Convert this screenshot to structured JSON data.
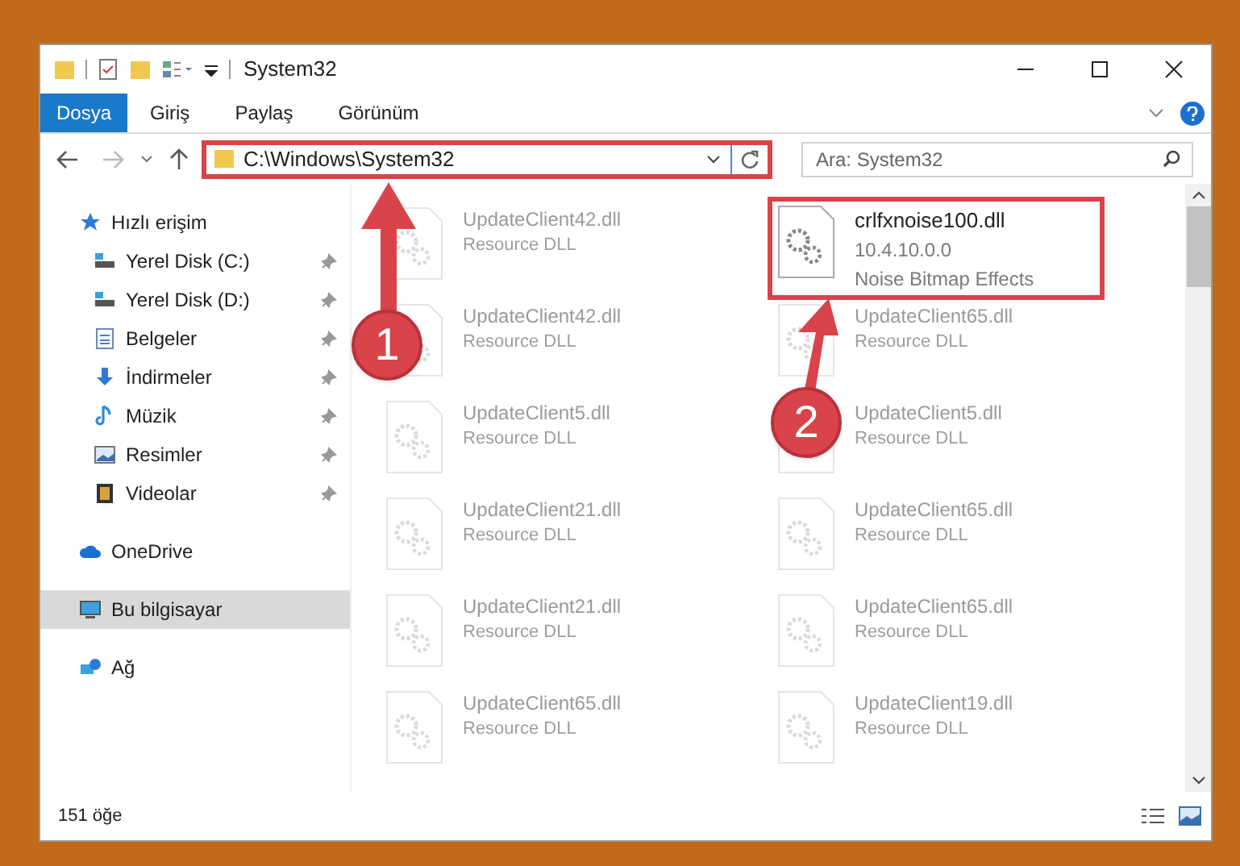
{
  "window": {
    "title": "System32"
  },
  "ribbon_tabs": [
    {
      "label": "Dosya",
      "selected": true
    },
    {
      "label": "Giriş",
      "selected": false
    },
    {
      "label": "Paylaş",
      "selected": false
    },
    {
      "label": "Görünüm",
      "selected": false
    }
  ],
  "address": {
    "path": "C:\\Windows\\System32"
  },
  "search": {
    "placeholder": "Ara: System32"
  },
  "sidebar": [
    {
      "label": "Hızlı erişim",
      "kind": "star",
      "pinned": false,
      "selected": false,
      "children": [
        {
          "label": "Yerel Disk (C:)",
          "kind": "drive",
          "pinned": true,
          "selected": false
        },
        {
          "label": "Yerel Disk (D:)",
          "kind": "drive",
          "pinned": true,
          "selected": false
        },
        {
          "label": "Belgeler",
          "kind": "document",
          "pinned": true,
          "selected": false
        },
        {
          "label": "İndirmeler",
          "kind": "download",
          "pinned": true,
          "selected": false
        },
        {
          "label": "Müzik",
          "kind": "music",
          "pinned": true,
          "selected": false
        },
        {
          "label": "Resimler",
          "kind": "pictures",
          "pinned": true,
          "selected": false
        },
        {
          "label": "Videolar",
          "kind": "video",
          "pinned": true,
          "selected": false
        }
      ]
    },
    {
      "label": "OneDrive",
      "kind": "cloud",
      "pinned": false,
      "selected": false
    },
    {
      "label": "Bu bilgisayar",
      "kind": "computer",
      "pinned": false,
      "selected": true
    },
    {
      "label": "Ağ",
      "kind": "network",
      "pinned": false,
      "selected": false
    }
  ],
  "files": [
    {
      "name": "UpdateClient42.dll",
      "details": [
        "Resource DLL"
      ],
      "kind": "blurred"
    },
    {
      "name": "crlfxnoise100.dll",
      "details": [
        "10.4.10.0.0",
        "Noise Bitmap Effects"
      ],
      "kind": "highlighted"
    },
    {
      "name": "UpdateClient42.dll",
      "details": [
        "Resource DLL"
      ],
      "kind": "blurred"
    },
    {
      "name": "UpdateClient65.dll",
      "details": [
        "Resource DLL"
      ],
      "kind": "blurred"
    },
    {
      "name": "UpdateClient5.dll",
      "details": [
        "Resource DLL"
      ],
      "kind": "blurred"
    },
    {
      "name": "UpdateClient5.dll",
      "details": [
        "Resource DLL"
      ],
      "kind": "blurred"
    },
    {
      "name": "UpdateClient21.dll",
      "details": [
        "Resource DLL"
      ],
      "kind": "blurred"
    },
    {
      "name": "UpdateClient65.dll",
      "details": [
        "Resource DLL"
      ],
      "kind": "blurred"
    },
    {
      "name": "UpdateClient21.dll",
      "details": [
        "Resource DLL"
      ],
      "kind": "blurred"
    },
    {
      "name": "UpdateClient65.dll",
      "details": [
        "Resource DLL"
      ],
      "kind": "blurred"
    },
    {
      "name": "UpdateClient65.dll",
      "details": [
        "Resource DLL"
      ],
      "kind": "blurred"
    },
    {
      "name": "UpdateClient19.dll",
      "details": [
        "Resource DLL"
      ],
      "kind": "blurred"
    }
  ],
  "status_bar": {
    "count": "151 öğe"
  },
  "callouts": [
    {
      "number": "1"
    },
    {
      "number": "2"
    }
  ]
}
